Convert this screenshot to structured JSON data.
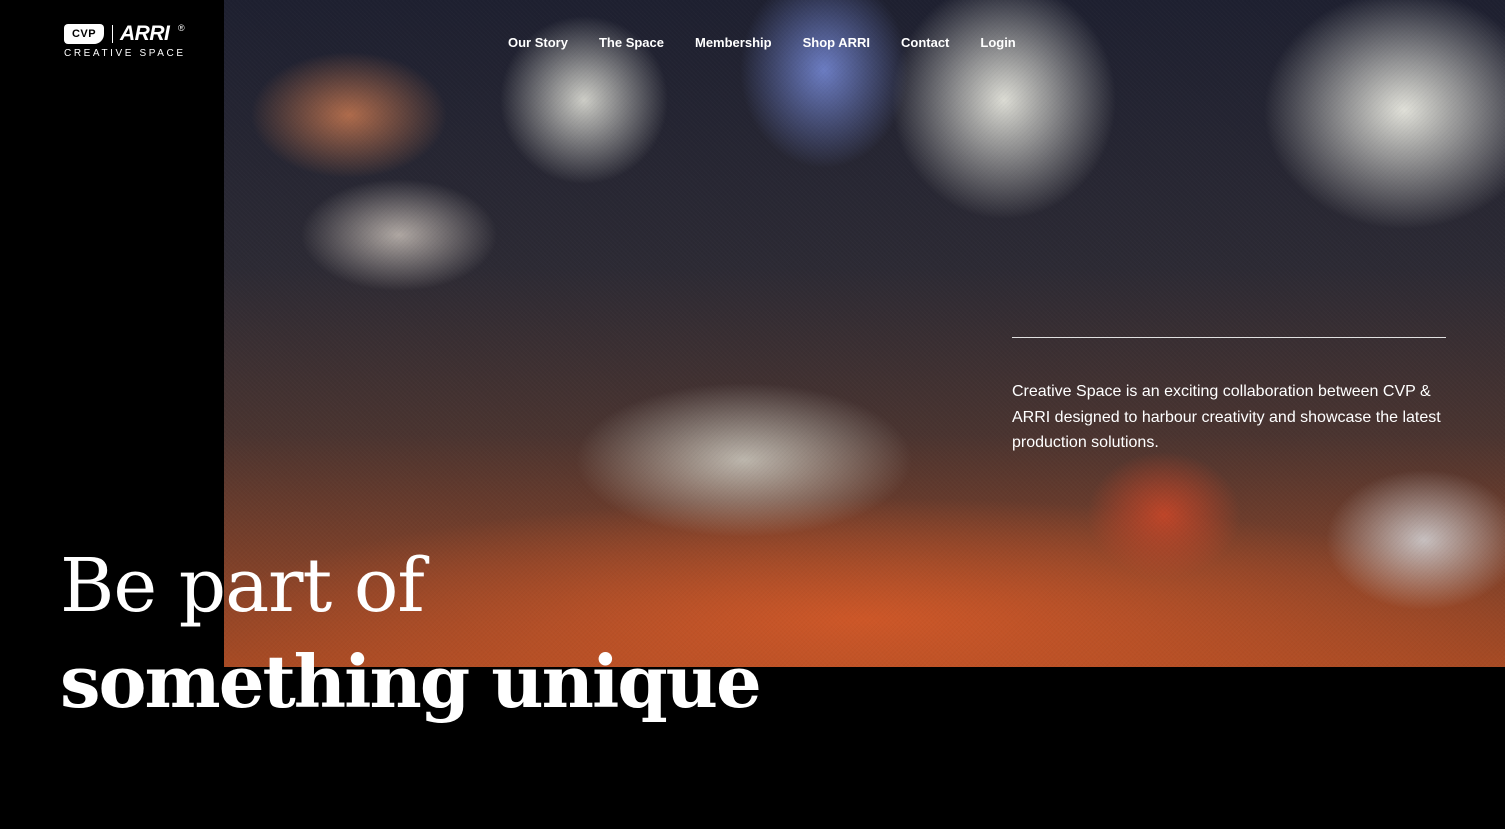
{
  "logo": {
    "cvp": "CVP",
    "arri": "ARRI",
    "registered": "®",
    "subtitle": "CREATIVE SPACE"
  },
  "nav": {
    "items": [
      {
        "label": "Our Story"
      },
      {
        "label": "The Space"
      },
      {
        "label": "Membership"
      },
      {
        "label": "Shop ARRI"
      },
      {
        "label": "Contact"
      },
      {
        "label": "Login"
      }
    ]
  },
  "hero": {
    "intro": "Creative Space is an exciting collaboration between CVP & ARRI designed to harbour creativity and showcase the latest production solutions.",
    "headline_line1": "Be part of",
    "headline_line2": "something unique"
  },
  "colors": {
    "background": "#000000",
    "text": "#ffffff"
  }
}
